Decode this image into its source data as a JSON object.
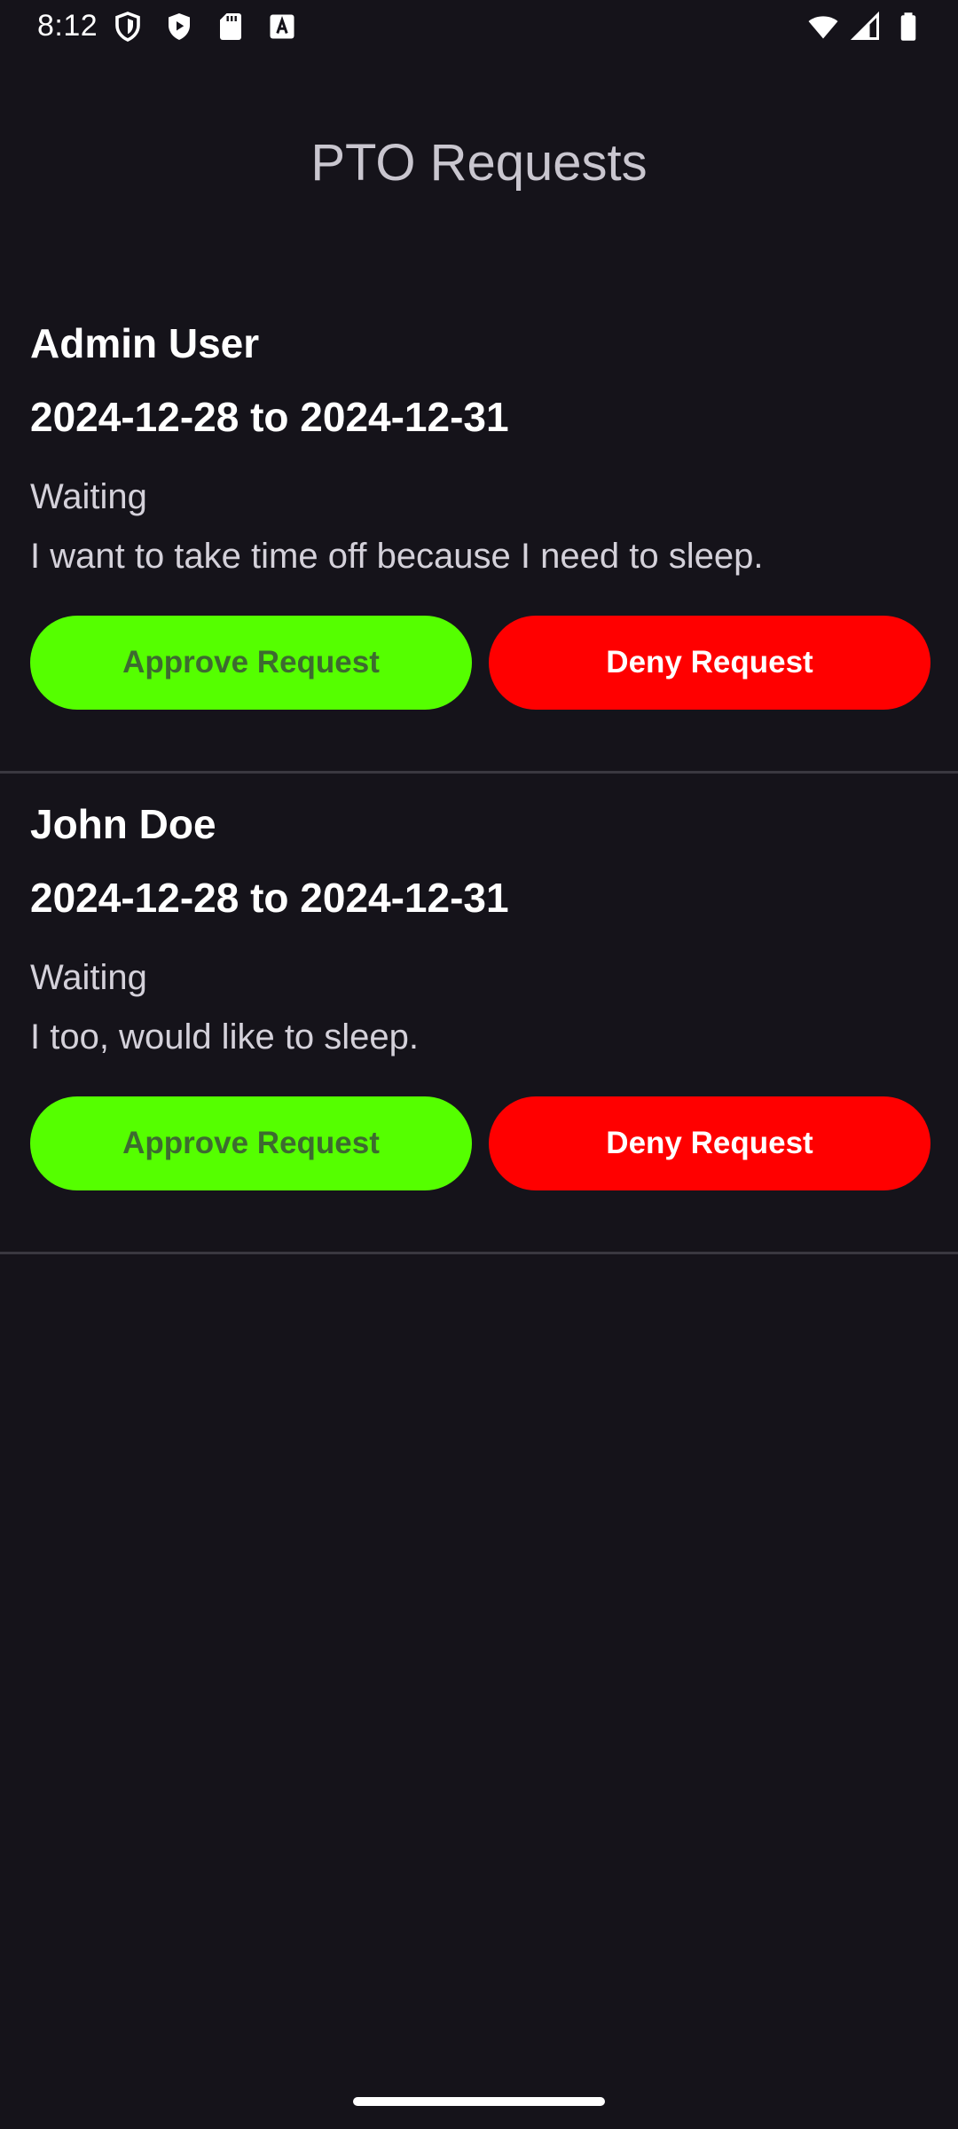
{
  "status_bar": {
    "time": "8:12",
    "left_icons": [
      "shield-icon",
      "play-protect-icon",
      "sd-card-icon",
      "font-a-icon"
    ],
    "right_icons": [
      "wifi-icon",
      "signal-icon",
      "battery-icon"
    ]
  },
  "header": {
    "title": "PTO Requests"
  },
  "requests": [
    {
      "name": "Admin User",
      "dates": "2024-12-28 to 2024-12-31",
      "status": "Waiting",
      "reason": "I want to take time off because I need to sleep.",
      "approve_label": "Approve Request",
      "deny_label": "Deny Request"
    },
    {
      "name": "John Doe",
      "dates": "2024-12-28 to 2024-12-31",
      "status": "Waiting",
      "reason": "I too, would like to sleep.",
      "approve_label": "Approve Request",
      "deny_label": "Deny Request"
    }
  ],
  "colors": {
    "background": "#15131a",
    "approve": "#55ff00",
    "deny": "#ff0000",
    "title": "#c9c6cf"
  }
}
